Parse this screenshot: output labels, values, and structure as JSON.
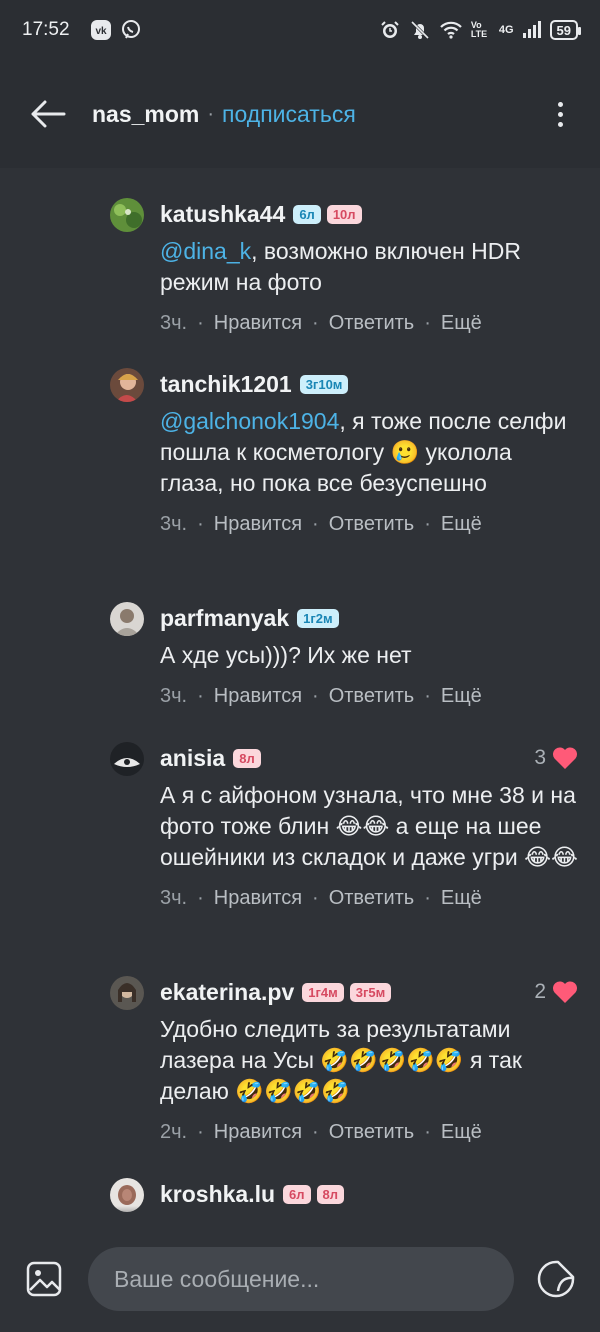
{
  "status_bar": {
    "time": "17:52",
    "network": "4G",
    "volte": "Vo LTE",
    "battery": "59"
  },
  "header": {
    "username": "nas_mom",
    "separator": "·",
    "subscribe_label": "подписаться"
  },
  "comments": [
    {
      "username": "katushka44",
      "badges": [
        "6л",
        "10л"
      ],
      "mention": "@dina_k",
      "text": ", возможно включен HDR режим на фото",
      "time": "3ч.",
      "like_label": "Нравится",
      "reply_label": "Ответить",
      "more_label": "Ещё"
    },
    {
      "username": "tanchik1201",
      "badges": [
        "3г10м"
      ],
      "mention": "@galchonok1904",
      "text": ", я тоже после селфи пошла к косметологу 🥲 уколола глаза, но пока все безуспешно",
      "time": "3ч.",
      "like_label": "Нравится",
      "reply_label": "Ответить",
      "more_label": "Ещё"
    },
    {
      "username": "parfmanyak",
      "badges": [
        "1г2м"
      ],
      "text": "А хде усы)))? Их же нет",
      "time": "3ч.",
      "like_label": "Нравится",
      "reply_label": "Ответить",
      "more_label": "Ещё"
    },
    {
      "username": "anisia",
      "badges": [
        "8л"
      ],
      "likes": "3",
      "text": "А я с айфоном узнала, что мне 38 и на фото тоже блин 😂😂 а еще на шее ошейники из складок и даже угри 😂😂",
      "time": "3ч.",
      "like_label": "Нравится",
      "reply_label": "Ответить",
      "more_label": "Ещё"
    },
    {
      "username": "ekaterina.pv",
      "badges": [
        "1г4м",
        "3г5м"
      ],
      "likes": "2",
      "text": "Удобно следить за результатами лазера на Усы 🤣🤣🤣🤣🤣 я так делаю 🤣🤣🤣🤣",
      "time": "2ч.",
      "like_label": "Нравится",
      "reply_label": "Ответить",
      "more_label": "Ещё"
    },
    {
      "username": "kroshka.lu",
      "badges": [
        "6л",
        "8л"
      ]
    }
  ],
  "composer": {
    "placeholder": "Ваше сообщение..."
  },
  "colors": {
    "background": "#2f3237",
    "accent": "#4db3e6",
    "heart": "#ff5a78",
    "badge_blue_bg": "#cdeffb",
    "badge_pink_bg": "#fbd7dc"
  }
}
